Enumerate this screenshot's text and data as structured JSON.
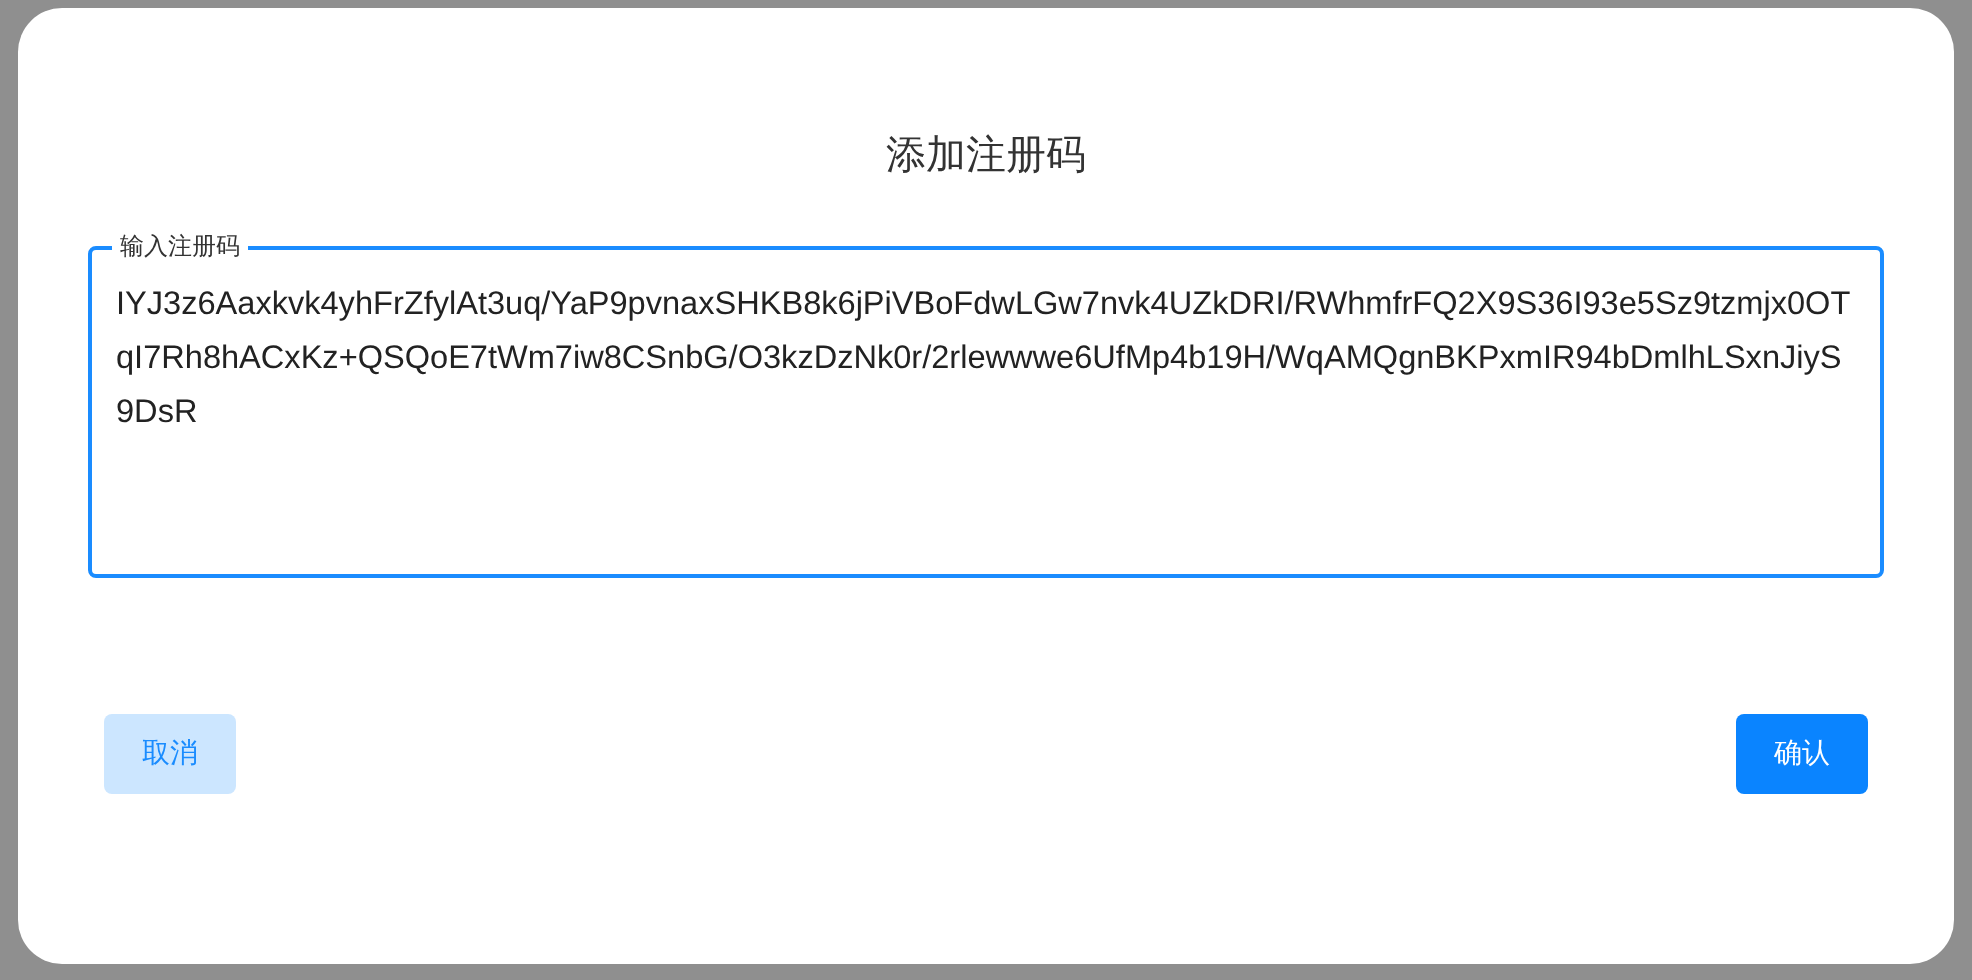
{
  "dialog": {
    "title": "添加注册码",
    "field": {
      "label": "输入注册码",
      "value": "IYJ3z6Aaxkvk4yhFrZfylAt3uq/YaP9pvnaxSHKB8k6jPiVBoFdwLGw7nvk4UZkDRI/RWhmfrFQ2X9S36I93e5Sz9tzmjx0OTqI7Rh8hACxKz+QSQoE7tWm7iw8CSnbG/O3kzDzNk0r/2rlewwwe6UfMp4b19H/WqAMQgnBKPxmIR94bDmlhLSxnJiyS9DsR",
      "focused": true
    },
    "buttons": [
      {
        "label": "取消",
        "kind": "secondary"
      },
      {
        "label": "确认",
        "kind": "primary"
      }
    ]
  }
}
